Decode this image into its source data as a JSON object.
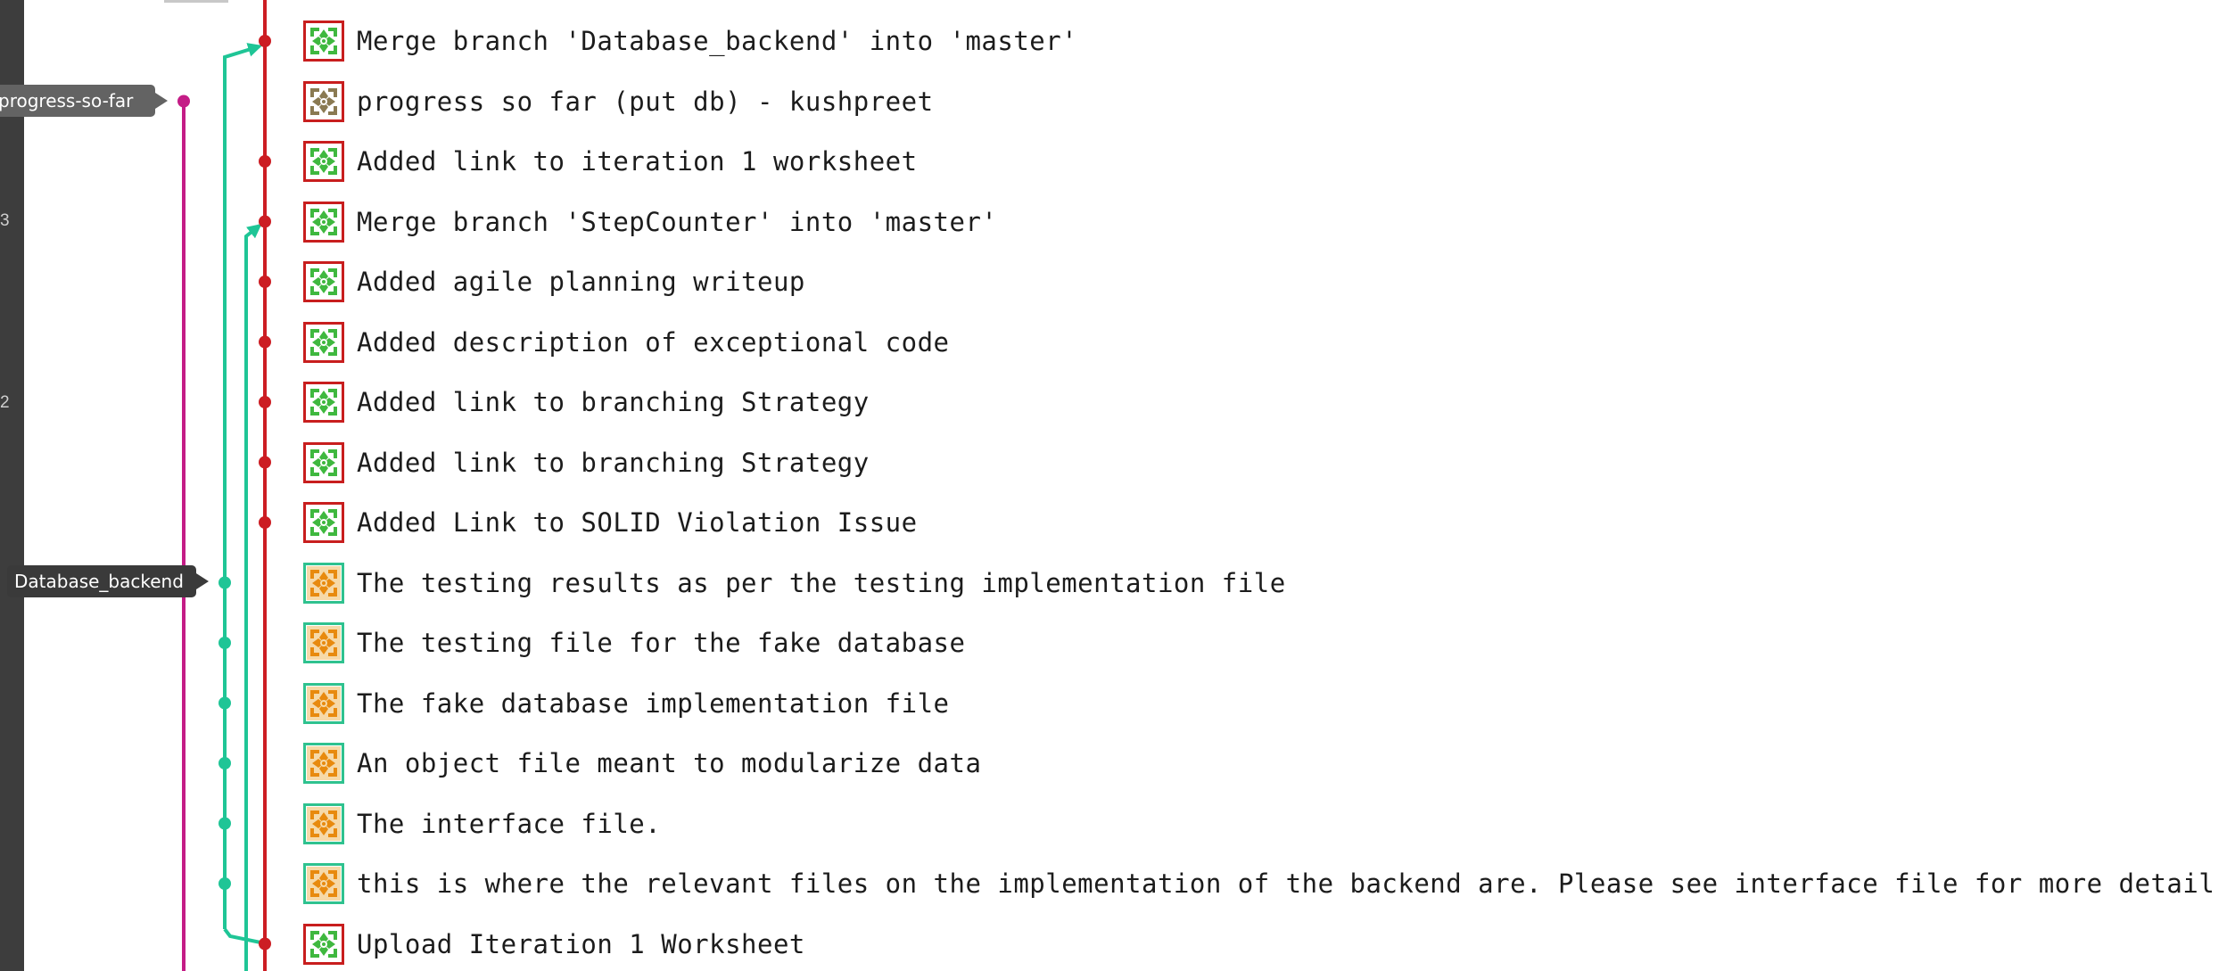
{
  "sidebar": {
    "line_numbers": [
      "3",
      "2"
    ]
  },
  "branch_labels": {
    "progress_so_far": "progress-so-far",
    "database_backend": "Database_backend"
  },
  "colors": {
    "master_line": "#cc1d23",
    "feature_line": "#1fc596",
    "progress_line": "#c41c86",
    "label_bg": "#636363",
    "database_label_bg": "#3a3a3a"
  },
  "commits": [
    {
      "message": "Merge branch 'Database_backend' into 'master'",
      "author_icon": "green-identicon-red-frame"
    },
    {
      "message": "progress so far (put db) - kushpreet",
      "author_icon": "tan-identicon-red-frame"
    },
    {
      "message": "Added link to iteration 1 worksheet",
      "author_icon": "green-identicon-red-frame"
    },
    {
      "message": "Merge branch 'StepCounter' into 'master'",
      "author_icon": "green-identicon-red-frame"
    },
    {
      "message": "Added agile planning writeup",
      "author_icon": "green-identicon-red-frame"
    },
    {
      "message": "Added description of exceptional code",
      "author_icon": "green-identicon-red-frame"
    },
    {
      "message": "Added link to branching Strategy",
      "author_icon": "green-identicon-red-frame"
    },
    {
      "message": "Added link to branching Strategy",
      "author_icon": "green-identicon-red-frame"
    },
    {
      "message": "Added Link to SOLID Violation Issue",
      "author_icon": "green-identicon-red-frame"
    },
    {
      "message": "The testing results as per the testing implementation file",
      "author_icon": "orange-identicon-green-frame"
    },
    {
      "message": "The testing file for the fake database",
      "author_icon": "orange-identicon-green-frame"
    },
    {
      "message": "The fake database implementation file",
      "author_icon": "orange-identicon-green-frame"
    },
    {
      "message": "An object file meant to modularize data",
      "author_icon": "orange-identicon-green-frame"
    },
    {
      "message": "The interface file.",
      "author_icon": "orange-identicon-green-frame"
    },
    {
      "message": "this is where the relevant files on the implementation of the backend are. Please see interface file for more detail",
      "author_icon": "orange-identicon-green-frame"
    },
    {
      "message": "Upload Iteration 1 Worksheet",
      "author_icon": "green-identicon-red-frame"
    }
  ]
}
